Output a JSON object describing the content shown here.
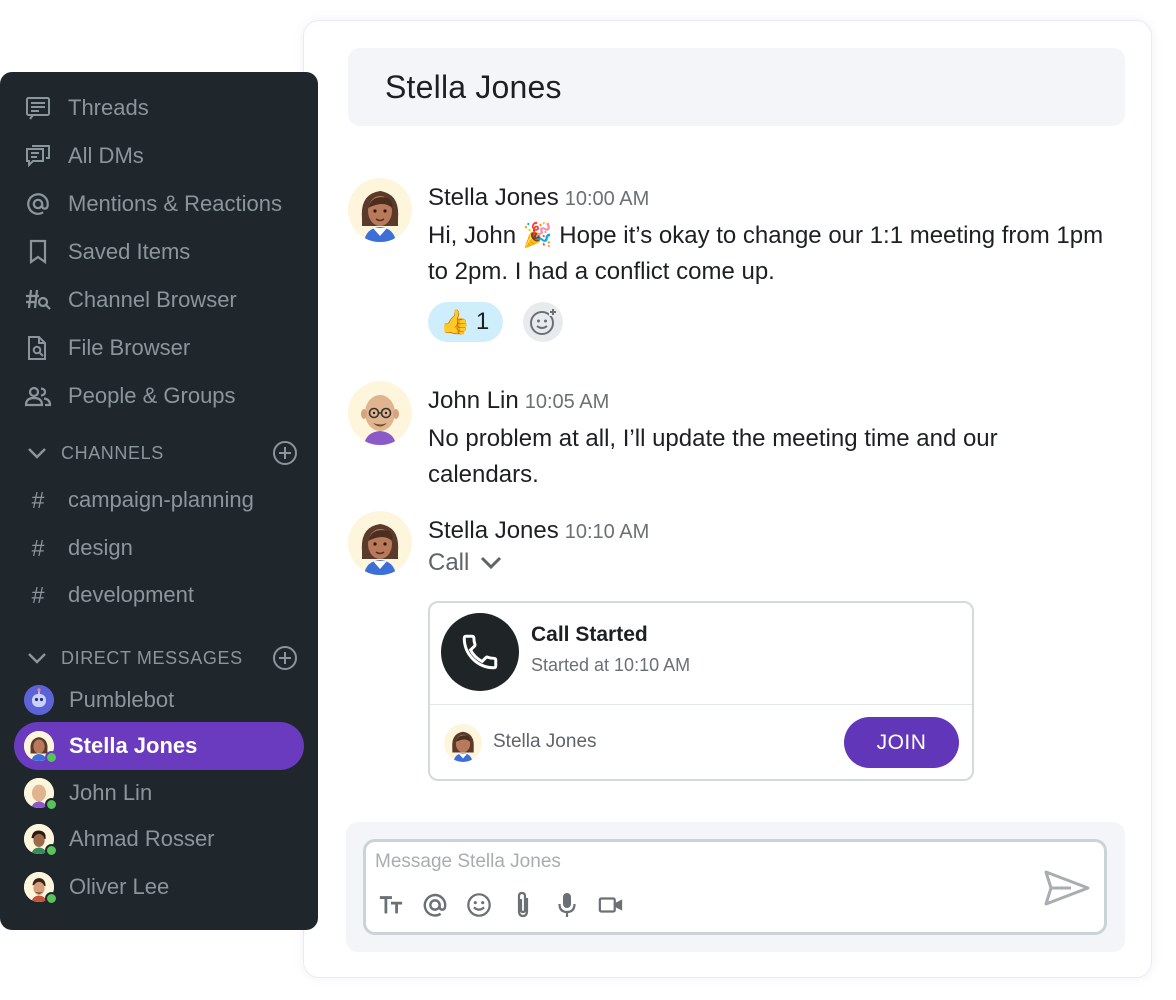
{
  "sidebar": {
    "nav": [
      {
        "label": "Threads",
        "icon": "threads-icon"
      },
      {
        "label": "All DMs",
        "icon": "all-dms-icon"
      },
      {
        "label": "Mentions & Reactions",
        "icon": "at-icon"
      },
      {
        "label": "Saved Items",
        "icon": "bookmark-icon"
      },
      {
        "label": "Channel Browser",
        "icon": "channel-search-icon"
      },
      {
        "label": "File Browser",
        "icon": "file-search-icon"
      },
      {
        "label": "People & Groups",
        "icon": "people-icon"
      }
    ],
    "channels_header": "CHANNELS",
    "channels": [
      "campaign-planning",
      "design",
      "development"
    ],
    "dms_header": "DIRECT MESSAGES",
    "dms": [
      {
        "name": "Pumblebot",
        "online": false,
        "active": false
      },
      {
        "name": "Stella Jones",
        "online": true,
        "active": true
      },
      {
        "name": "John Lin",
        "online": true,
        "active": false
      },
      {
        "name": "Ahmad Rosser",
        "online": true,
        "active": false
      },
      {
        "name": "Oliver Lee",
        "online": true,
        "active": false
      }
    ]
  },
  "header": {
    "title": "Stella Jones"
  },
  "messages": [
    {
      "author": "Stella Jones",
      "time": "10:00 AM",
      "text_line1": "Hi, John 🎉 Hope it’s okay to change our 1:1 meeting from 1pm",
      "text_line2": "to 2pm. I had a conflict come up.",
      "reaction": {
        "emoji": "👍",
        "count": "1"
      }
    },
    {
      "author": "John Lin",
      "time": "10:05 AM",
      "text_line1": "No problem at all, I’ll update the meeting time and our",
      "text_line2": "calendars."
    },
    {
      "author": "Stella Jones",
      "time": "10:10 AM",
      "call_label": "Call"
    }
  ],
  "call_card": {
    "title": "Call Started",
    "subtitle": "Started at 10:10 AM",
    "participant": "Stella Jones",
    "join_label": "JOIN"
  },
  "composer": {
    "placeholder": "Message Stella Jones"
  },
  "colors": {
    "sidebar_bg": "#1f272c",
    "accent": "#6a3abf",
    "join_button": "#6236b8",
    "presence": "#56c35b",
    "reaction_bg": "#cfeefb"
  }
}
